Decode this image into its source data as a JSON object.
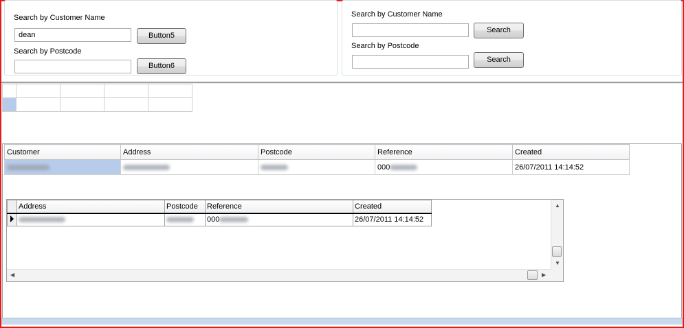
{
  "left_search": {
    "name_label": "Search by Customer Name",
    "name_value": "dean",
    "name_button": "Button5",
    "postcode_label": "Search by Postcode",
    "postcode_value": "",
    "postcode_button": "Button6"
  },
  "right_search": {
    "name_label": "Search by Customer Name",
    "name_value": "",
    "name_button": "Search",
    "postcode_label": "Search by Postcode",
    "postcode_value": "",
    "postcode_button": "Search"
  },
  "customer_grid": {
    "columns": [
      "Customer",
      "Address",
      "Postcode",
      "Reference",
      "Created"
    ],
    "row": {
      "reference_prefix": "000",
      "created": "26/07/2011 14:14:52"
    }
  },
  "detail_grid": {
    "columns": [
      "Address",
      "Postcode",
      "Reference",
      "Created"
    ],
    "row": {
      "reference_prefix": "000",
      "created": "26/07/2011 14:14:52"
    }
  },
  "icons": {
    "row_pointer": "row-pointer-icon",
    "scroll_up": "scroll-up-icon",
    "scroll_down": "scroll-down-icon",
    "scroll_left": "scroll-left-icon",
    "scroll_right": "scroll-right-icon"
  },
  "colors": {
    "window_border": "#e41b17",
    "selection": "#b7cbea"
  }
}
